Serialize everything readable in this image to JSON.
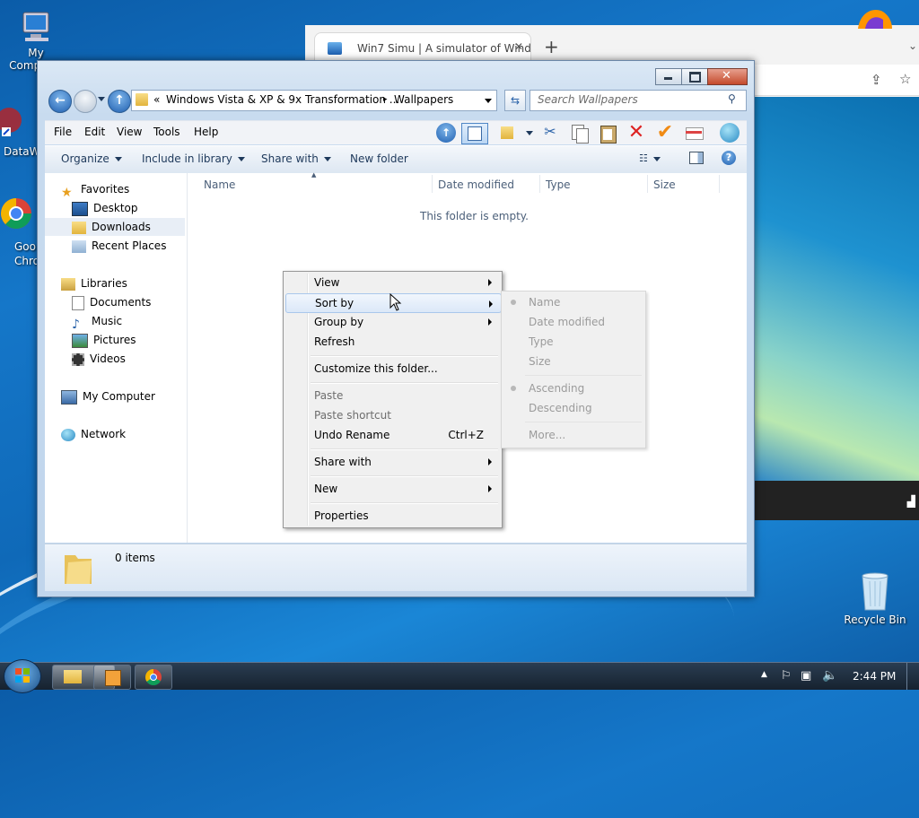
{
  "desktop": {
    "icons": [
      {
        "label": "My Computer"
      },
      {
        "label": "DataWa"
      },
      {
        "label": "Goo"
      },
      {
        "label": "Chro"
      },
      {
        "label": "Recycle Bin"
      }
    ]
  },
  "browser": {
    "tab_title": "Win7 Simu | A simulator of Wind",
    "new_tab": "+"
  },
  "explorer": {
    "breadcrumb": {
      "chevrons": "«",
      "segment1": "Windows Vista & XP & 9x Transformation ...",
      "sep": "▸",
      "segment2": "Wallpapers"
    },
    "search_placeholder": "Search Wallpapers",
    "menu": [
      "File",
      "Edit",
      "View",
      "Tools",
      "Help"
    ],
    "commands": {
      "organize": "Organize",
      "include": "Include in library",
      "share": "Share with",
      "new_folder": "New folder"
    },
    "nav": {
      "favorites": "Favorites",
      "desktop": "Desktop",
      "downloads": "Downloads",
      "recent": "Recent Places",
      "libraries": "Libraries",
      "documents": "Documents",
      "music": "Music",
      "pictures": "Pictures",
      "videos": "Videos",
      "my_computer": "My Computer",
      "network": "Network"
    },
    "columns": {
      "name": "Name",
      "date": "Date modified",
      "type": "Type",
      "size": "Size"
    },
    "empty_text": "This folder is empty.",
    "status": "0 items"
  },
  "context_menu": {
    "view": "View",
    "sort_by": "Sort by",
    "group_by": "Group by",
    "refresh": "Refresh",
    "customize": "Customize this folder...",
    "paste": "Paste",
    "paste_shortcut": "Paste shortcut",
    "undo_rename": "Undo Rename",
    "undo_shortcut": "Ctrl+Z",
    "share_with": "Share with",
    "new": "New",
    "properties": "Properties"
  },
  "sort_submenu": {
    "name": "Name",
    "date": "Date modified",
    "type": "Type",
    "size": "Size",
    "ascending": "Ascending",
    "descending": "Descending",
    "more": "More..."
  },
  "taskbar": {
    "time": "2:44 PM"
  },
  "colors": {
    "accent": "#1f5fb0",
    "highlight": "#dbe8f8",
    "taskbar": "#1c2a3a"
  }
}
